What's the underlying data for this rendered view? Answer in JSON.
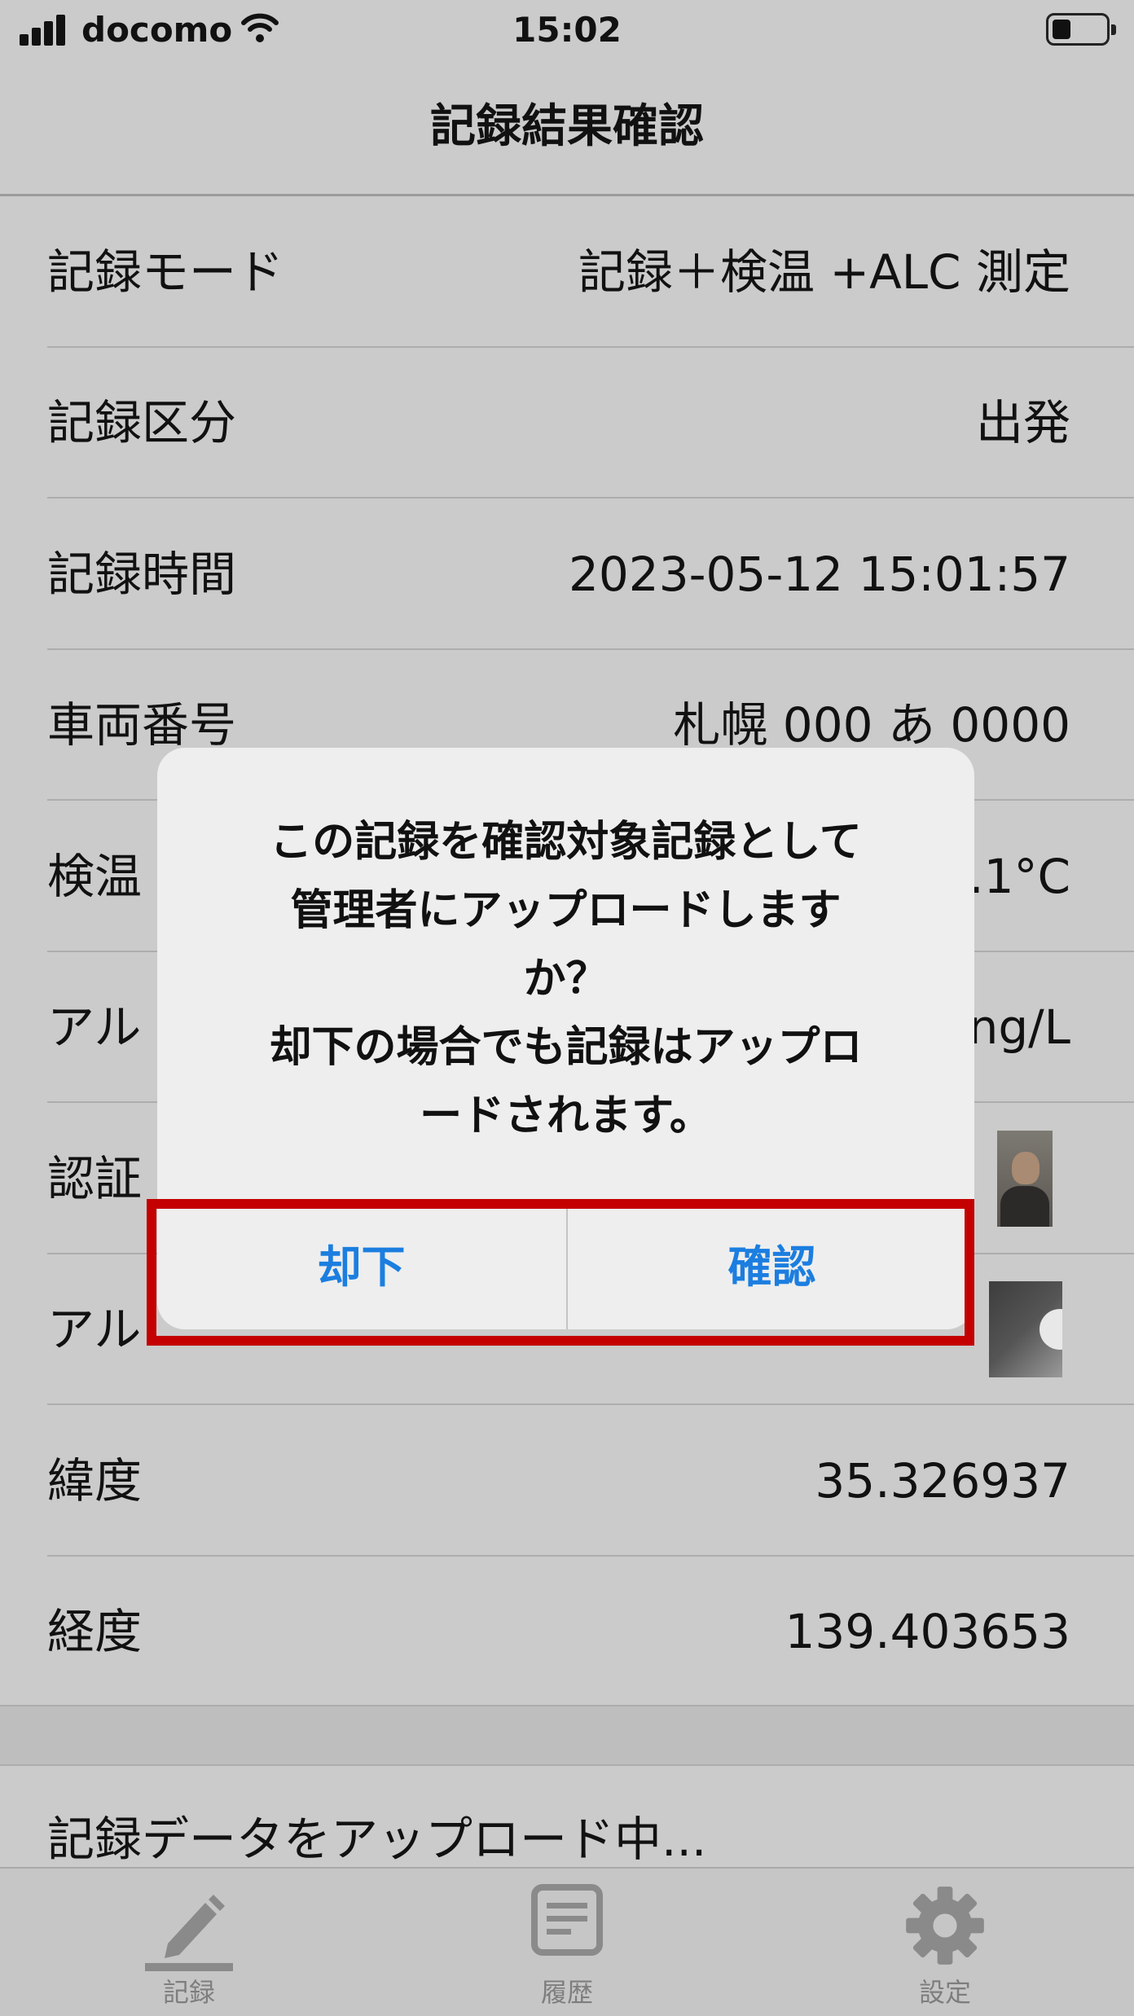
{
  "status_bar": {
    "carrier": "docomo",
    "time": "15:02",
    "icons": [
      "signal-icon",
      "wifi-icon",
      "battery-icon"
    ]
  },
  "nav": {
    "title": "記録結果確認"
  },
  "rows": [
    {
      "label": "記録モード",
      "value": "記録＋検温 +ALC 測定"
    },
    {
      "label": "記録区分",
      "value": "出発"
    },
    {
      "label": "記録時間",
      "value": "2023-05-12 15:01:57"
    },
    {
      "label": "車両番号",
      "value": "札幌 000 あ 0000"
    },
    {
      "label": "検温",
      "value": ".1°C"
    },
    {
      "label": "アル",
      "value": "ng/L"
    },
    {
      "label": "認証",
      "value": ""
    },
    {
      "label": "アル",
      "value": ""
    },
    {
      "label": "緯度",
      "value": "35.326937"
    },
    {
      "label": "経度",
      "value": "139.403653"
    }
  ],
  "uploading_text": "記録データをアップロード中...",
  "dialog": {
    "message": "この記録を確認対象記録として\n管理者にアップロードします\nか？\n却下の場合でも記録はアップロ\nードされます。",
    "reject_label": "却下",
    "confirm_label": "確認",
    "button_color": "#1b7ee0"
  },
  "highlight_color": "#c40000",
  "tabs": [
    {
      "label": "記録",
      "icon": "pencil-icon"
    },
    {
      "label": "履歴",
      "icon": "document-icon"
    },
    {
      "label": "設定",
      "icon": "gear-icon"
    }
  ]
}
